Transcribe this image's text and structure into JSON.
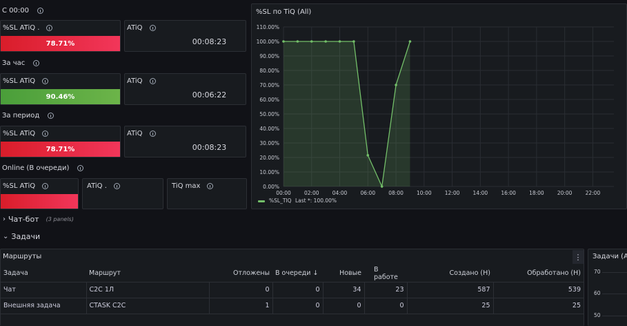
{
  "sections": {
    "since_midnight": "С 00:00",
    "per_hour": "За час",
    "per_period": "За период",
    "online": "Online (В очереди)"
  },
  "stats": {
    "row1": {
      "sl_title": "%SL ATiQ .",
      "sl_value": "78.71%",
      "sl_color": "#e02f44",
      "atiq_title": "ATiQ",
      "atiq_value": "00:08:23"
    },
    "row2": {
      "sl_title": "%SL ATiQ",
      "sl_value": "90.46%",
      "sl_color": "#56a64b",
      "atiq_title": "ATiQ",
      "atiq_value": "00:06:22"
    },
    "row3": {
      "sl_title": "%SL ATiQ",
      "sl_value": "78.71%",
      "sl_color": "#e02f44",
      "atiq_title": "ATiQ",
      "atiq_value": "00:08:23"
    },
    "row4": {
      "sl_title": "%SL ATiQ",
      "atiq_title": "ATiQ .",
      "tiqmax_title": "TiQ max"
    }
  },
  "chart_panel_title": "%SL по TiQ (All)",
  "chart_data": {
    "type": "area",
    "title": "%SL по TiQ (All)",
    "x": [
      "00:00",
      "01:00",
      "02:00",
      "03:00",
      "04:00",
      "05:00",
      "06:00",
      "07:00",
      "08:00",
      "09:00"
    ],
    "series": [
      {
        "name": "%SL_TIQ",
        "values": [
          100,
          100,
          100,
          100,
          100,
          100,
          21.5,
          0,
          70,
          100
        ],
        "color": "#73bf69"
      }
    ],
    "x_ticks": [
      "00:00",
      "02:00",
      "04:00",
      "06:00",
      "08:00",
      "10:00",
      "12:00",
      "14:00",
      "16:00",
      "18:00",
      "20:00",
      "22:00"
    ],
    "y_ticks": [
      "0.00%",
      "10.00%",
      "20.00%",
      "30.00%",
      "40.00%",
      "50.00%",
      "60.00%",
      "70.00%",
      "80.00%",
      "90.00%",
      "100.00%",
      "110.00%"
    ],
    "xlim": [
      0,
      23.5
    ],
    "ylim": [
      0,
      110
    ],
    "legend": {
      "label": "%SL_TIQ",
      "stat": "Last *: 100.00%"
    }
  },
  "rows": {
    "chatbot": {
      "title": "Чат-бот",
      "meta": "(3 panels)"
    },
    "tasks": {
      "title": "Задачи"
    }
  },
  "routes_panel": {
    "title": "Маршруты",
    "columns": [
      "Задача",
      "Маршрут",
      "Отложены",
      "В очереди",
      "Новые",
      "В работе",
      "Создано (Н)",
      "Обработано (Н)"
    ],
    "sort_icon": "↓",
    "rows": [
      [
        "Чат",
        "C2C 1Л",
        "0",
        "0",
        "34",
        "23",
        "587",
        "539"
      ],
      [
        "Внешняя задача",
        "CTASK C2C",
        "1",
        "0",
        "0",
        "0",
        "25",
        "25"
      ]
    ]
  },
  "tasks_panel": {
    "title": "Задачи (All)",
    "y_ticks": [
      "70",
      "60",
      "50"
    ]
  }
}
